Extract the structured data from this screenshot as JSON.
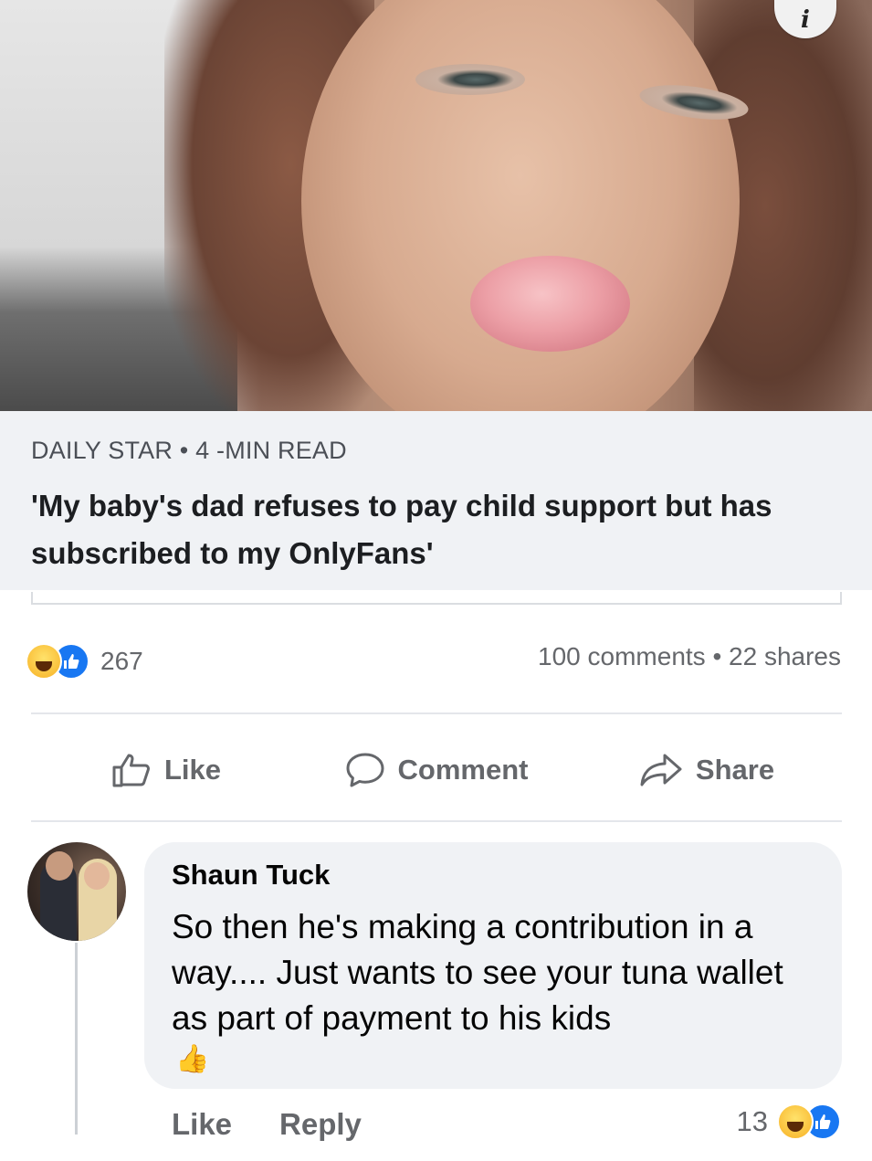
{
  "post": {
    "info_badge": "i",
    "source": "DAILY STAR • 4 -MIN READ",
    "headline": "'My baby's dad refuses to pay child support but has subscribed to my OnlyFans'",
    "reaction_count": "267",
    "stats": "100 comments • 22 shares",
    "actions": {
      "like": "Like",
      "comment": "Comment",
      "share": "Share"
    }
  },
  "comment": {
    "author": "Shaun Tuck",
    "text": "So then he's making a contribution in a way.... Just wants to see your tuna wallet as part of payment to his kids",
    "emoji": "👍",
    "like": "Like",
    "reply": "Reply",
    "reaction_count": "13"
  },
  "icons": {
    "reactions": [
      "haha-icon",
      "like-reaction-icon"
    ],
    "actions": [
      "thumbs-up-icon",
      "speech-bubble-icon",
      "share-arrow-icon"
    ]
  },
  "colors": {
    "facebook_blue": "#1877f2",
    "muted_text": "#65676b",
    "preview_bg": "#f0f2f5"
  }
}
